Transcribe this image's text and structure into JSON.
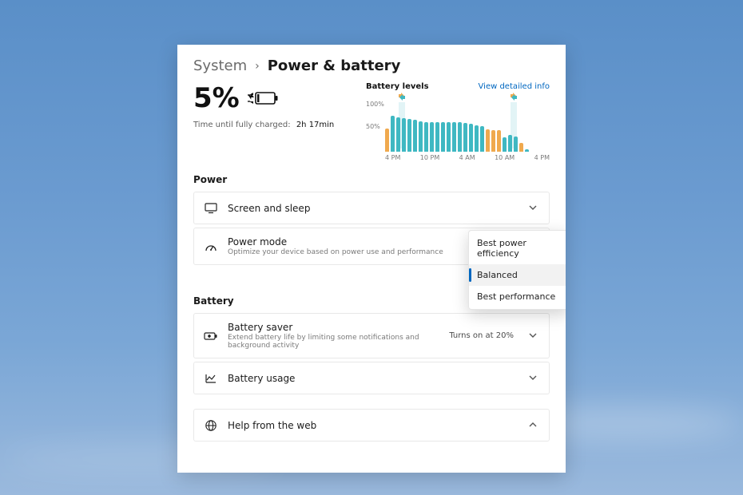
{
  "breadcrumb": {
    "parent": "System",
    "current": "Power & battery"
  },
  "battery": {
    "percent": "5%",
    "charge_label": "Time until fully charged:",
    "charge_value": "2h 17min"
  },
  "chart": {
    "title": "Battery levels",
    "link": "View detailed info",
    "y_ticks": [
      "100%",
      "50%"
    ]
  },
  "chart_data": {
    "type": "bar",
    "title": "Battery levels",
    "categories": [
      "4 PM",
      "",
      "",
      "10 PM",
      "",
      "",
      "4 AM",
      "",
      "",
      "10 AM",
      "",
      "",
      "4 PM"
    ],
    "x_ticks": [
      "4 PM",
      "10 PM",
      "4 AM",
      "10 AM",
      "4 PM"
    ],
    "ylabel": "",
    "ylim": [
      0,
      100
    ],
    "values": [
      48,
      75,
      72,
      70,
      68,
      66,
      64,
      62,
      62,
      62,
      62,
      62,
      62,
      62,
      60,
      58,
      55,
      54,
      46,
      45,
      45,
      30,
      35,
      32,
      18,
      5
    ],
    "colors": [
      "orange",
      "teal",
      "teal",
      "teal",
      "teal",
      "teal",
      "teal",
      "teal",
      "teal",
      "teal",
      "teal",
      "teal",
      "teal",
      "teal",
      "teal",
      "teal",
      "teal",
      "teal",
      "orange",
      "orange",
      "orange",
      "teal",
      "teal",
      "teal",
      "orange",
      "teal"
    ],
    "charge_markers_pct": [
      10,
      78
    ]
  },
  "sections": {
    "power": "Power",
    "battery": "Battery"
  },
  "cards": {
    "screen_sleep": {
      "title": "Screen and sleep"
    },
    "power_mode": {
      "title": "Power mode",
      "sub": "Optimize your device based on power use and performance"
    },
    "battery_saver": {
      "title": "Battery saver",
      "sub": "Extend battery life by limiting some notifications and background activity",
      "trail": "Turns on at 20%"
    },
    "battery_usage": {
      "title": "Battery usage"
    },
    "help_web": {
      "title": "Help from the web"
    }
  },
  "power_mode_menu": {
    "items": [
      "Best power efficiency",
      "Balanced",
      "Best performance"
    ],
    "selected_index": 1
  }
}
